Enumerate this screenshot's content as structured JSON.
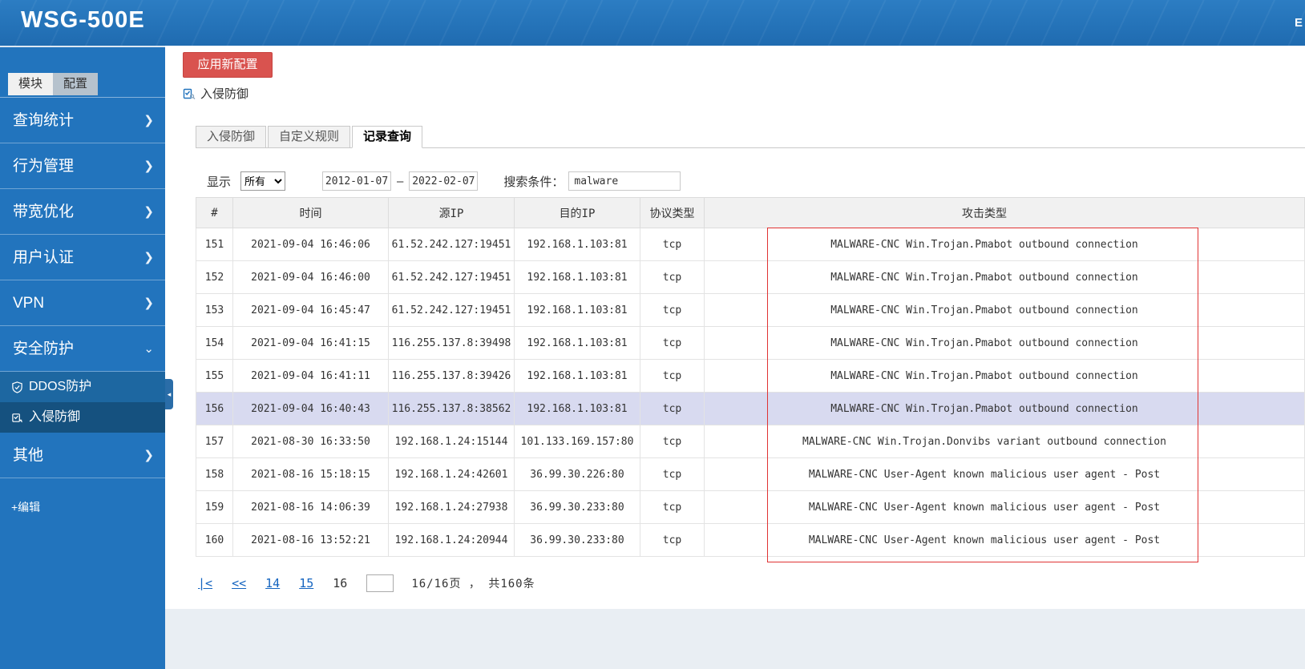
{
  "colors": {
    "header_blue": "#2274bd",
    "submenu_blue": "#1d67a1",
    "submenu_active": "#15517f",
    "accent_red": "#d9534f",
    "link_blue": "#1464c0",
    "row_highlight": "#d8daf0",
    "red_box_border": "#e03333"
  },
  "header": {
    "title": "WSG-500E",
    "right_text": "E"
  },
  "sidebar": {
    "mode_tabs": [
      {
        "label": "模块",
        "active": true
      },
      {
        "label": "配置",
        "active": false
      }
    ],
    "items": [
      {
        "label": "查询统计",
        "arrow": "❯"
      },
      {
        "label": "行为管理",
        "arrow": "❯"
      },
      {
        "label": "带宽优化",
        "arrow": "❯"
      },
      {
        "label": "用户认证",
        "arrow": "❯"
      },
      {
        "label": "VPN",
        "arrow": "❯"
      },
      {
        "label": "安全防护",
        "arrow": "⌄"
      }
    ],
    "subitems": [
      {
        "label": "DDOS防护",
        "icon": "shield-check-icon",
        "active": false
      },
      {
        "label": "入侵防御",
        "icon": "intrusion-defense-icon",
        "active": true
      }
    ],
    "items_after": [
      {
        "label": "其他",
        "arrow": "❯"
      }
    ],
    "edit_label": "+编辑",
    "collapse_arrow": "◂"
  },
  "toolbar": {
    "apply_button_label": "应用新配置"
  },
  "breadcrumb": {
    "label": "入侵防御"
  },
  "content_tabs": [
    {
      "label": "入侵防御",
      "active": false
    },
    {
      "label": "自定义规则",
      "active": false
    },
    {
      "label": "记录查询",
      "active": true
    }
  ],
  "filters": {
    "show_label": "显示",
    "show_select_value": "所有",
    "date_from": "2012-01-07",
    "date_separator": "–",
    "date_to": "2022-02-07",
    "search_label": "搜索条件：",
    "search_value": "malware"
  },
  "table": {
    "columns": [
      "#",
      "时间",
      "源IP",
      "目的IP",
      "协议类型",
      "攻击类型"
    ],
    "highlighted_index": 5,
    "rows": [
      [
        "151",
        "2021-09-04 16:46:06",
        "61.52.242.127:19451",
        "192.168.1.103:81",
        "tcp",
        "MALWARE-CNC Win.Trojan.Pmabot outbound connection"
      ],
      [
        "152",
        "2021-09-04 16:46:00",
        "61.52.242.127:19451",
        "192.168.1.103:81",
        "tcp",
        "MALWARE-CNC Win.Trojan.Pmabot outbound connection"
      ],
      [
        "153",
        "2021-09-04 16:45:47",
        "61.52.242.127:19451",
        "192.168.1.103:81",
        "tcp",
        "MALWARE-CNC Win.Trojan.Pmabot outbound connection"
      ],
      [
        "154",
        "2021-09-04 16:41:15",
        "116.255.137.8:39498",
        "192.168.1.103:81",
        "tcp",
        "MALWARE-CNC Win.Trojan.Pmabot outbound connection"
      ],
      [
        "155",
        "2021-09-04 16:41:11",
        "116.255.137.8:39426",
        "192.168.1.103:81",
        "tcp",
        "MALWARE-CNC Win.Trojan.Pmabot outbound connection"
      ],
      [
        "156",
        "2021-09-04 16:40:43",
        "116.255.137.8:38562",
        "192.168.1.103:81",
        "tcp",
        "MALWARE-CNC Win.Trojan.Pmabot outbound connection"
      ],
      [
        "157",
        "2021-08-30 16:33:50",
        "192.168.1.24:15144",
        "101.133.169.157:80",
        "tcp",
        "MALWARE-CNC Win.Trojan.Donvibs variant outbound connection"
      ],
      [
        "158",
        "2021-08-16 15:18:15",
        "192.168.1.24:42601",
        "36.99.30.226:80",
        "tcp",
        "MALWARE-CNC User-Agent known malicious user agent - Post"
      ],
      [
        "159",
        "2021-08-16 14:06:39",
        "192.168.1.24:27938",
        "36.99.30.233:80",
        "tcp",
        "MALWARE-CNC User-Agent known malicious user agent - Post"
      ],
      [
        "160",
        "2021-08-16 13:52:21",
        "192.168.1.24:20944",
        "36.99.30.233:80",
        "tcp",
        "MALWARE-CNC User-Agent known malicious user agent - Post"
      ]
    ]
  },
  "pagination": {
    "first_label": "|<",
    "prev_label": "<<",
    "page_links": [
      "14",
      "15"
    ],
    "current_page": "16",
    "input_value": "",
    "summary": "16/16页 ， 共160条"
  }
}
